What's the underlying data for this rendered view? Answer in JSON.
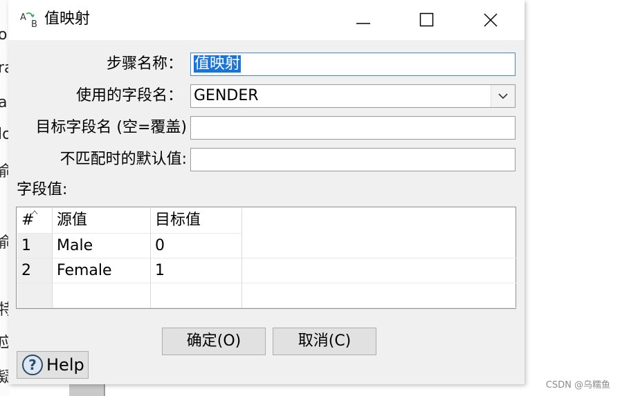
{
  "background": {
    "fragments": [
      "oi",
      "ra",
      "a",
      "lo",
      "俞",
      "俞",
      "特",
      "应",
      "疑"
    ],
    "watermark": "CSDN @乌糯鱼"
  },
  "dialog": {
    "title": "值映射",
    "icon": "ab-mapping-icon",
    "window_controls": [
      "minimize-icon",
      "maximize-icon",
      "close-icon"
    ]
  },
  "form": {
    "step_name_label": "步骤名称：",
    "step_name_value": "值映射",
    "field_label": "使用的字段名：",
    "field_value": "GENDER",
    "target_label": "目标字段名 (空=覆盖)",
    "target_value": "",
    "default_label": "不匹配时的默认值:",
    "default_value": ""
  },
  "table": {
    "section_label": "字段值:",
    "headers": [
      "#",
      "源值",
      "目标值"
    ],
    "rows": [
      [
        "1",
        "Male",
        "0"
      ],
      [
        "2",
        "Female",
        "1"
      ]
    ]
  },
  "buttons": {
    "ok": "确定(O)",
    "cancel": "取消(C)",
    "help": "Help"
  },
  "colors": {
    "selection": "#1874d9",
    "focus_border": "#3a8dd1",
    "button_face": "#e1e1e1"
  }
}
